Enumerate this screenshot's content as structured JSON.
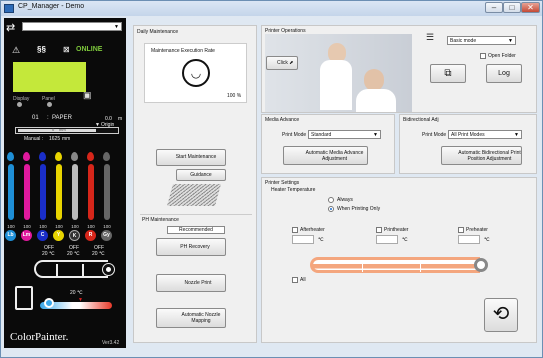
{
  "window": {
    "title": "CP_Manager - Demo",
    "min": "–",
    "max": "□",
    "close": "✕"
  },
  "left": {
    "status_online": "ONLINE",
    "display_label": "Display",
    "panel_label": "Panel",
    "media_number": "01",
    "media_name": "PAPER",
    "media_length": "0.0",
    "media_unit": "m",
    "origin_label": "Origin",
    "mm_value": "0",
    "mm_unit": "mm",
    "manual_label": "Manual :",
    "manual_value": "1625",
    "manual_unit": "mm",
    "inks": [
      {
        "v": "100",
        "l": "Lb",
        "c": "#1e8fd6"
      },
      {
        "v": "100",
        "l": "Lm",
        "c": "#e0199d"
      },
      {
        "v": "100",
        "l": "C",
        "c": "#1a2ec9"
      },
      {
        "v": "100",
        "l": "Y",
        "c": "#e8d400"
      },
      {
        "v": "100",
        "l": "K",
        "c": "#333"
      },
      {
        "v": "100",
        "l": "R",
        "c": "#d6261a"
      },
      {
        "v": "100",
        "l": "Gy",
        "c": "#666"
      }
    ],
    "heaters": [
      {
        "s": "OFF",
        "t": "20 ℃"
      },
      {
        "s": "OFF",
        "t": "20 ℃"
      },
      {
        "s": "OFF",
        "t": "20 ℃"
      }
    ],
    "bottom_temp": "20 ℃",
    "logo": "ColorPainter.",
    "version": "Ver3.42"
  },
  "daily": {
    "title": "Daily Maintenance",
    "rate_title": "Maintenance Execution Rate",
    "rate_value": "100 %",
    "start_btn": "Start Maintenance",
    "guidance_btn": "Guidance"
  },
  "ph": {
    "title": "PH Maintenance",
    "recommended": "Recommended",
    "recovery_btn": "PH Recovery",
    "nozzle_print_btn": "Nozzle Print",
    "nozzle_mapping_btn": "Automatic Nozzle Mapping"
  },
  "printer_ops": {
    "title": "Printer Operations",
    "click_btn": "Click",
    "mode_value": "Basic mode",
    "open_folder": "Open Folder",
    "log_btn": "Log"
  },
  "media_adv": {
    "title": "Media Advance",
    "print_mode_label": "Print Mode",
    "print_mode_value": "Standard",
    "auto_btn": "Automatic Media Advance Adjustment"
  },
  "bidir": {
    "title": "Bidirectional Adj",
    "print_mode_label": "Print Mode",
    "print_mode_value": "All Print Modes",
    "auto_btn": "Automatic Bidirectional Print Position Adjustment"
  },
  "settings": {
    "title": "Printer Settings",
    "heater_title": "Heater Temperature",
    "always": "Always",
    "when_printing": "When Printing Only",
    "afterheater": "Afterheater",
    "printheater": "Printheater",
    "preheater": "Preheater",
    "unit": "℃",
    "all": "All"
  },
  "colors": {
    "accent": "#f4a67e",
    "lcd": "#c4e83a"
  }
}
